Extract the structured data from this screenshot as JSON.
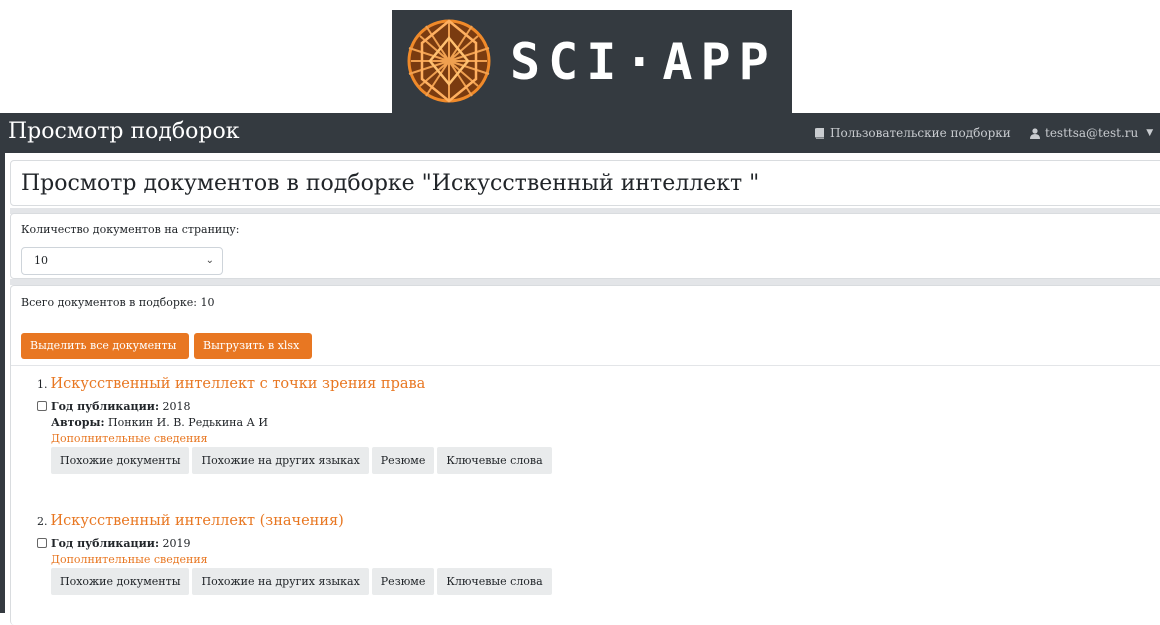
{
  "logo": {
    "text": "SCI·APP"
  },
  "navbar": {
    "brand": "Просмотр подборок",
    "collections_link": "Пользовательские подборки",
    "user": "testtsa@test.ru"
  },
  "page": {
    "title": "Просмотр документов в подборке \"Искусственный интеллект \""
  },
  "per_page": {
    "label": "Количество документов на страницу:",
    "selected": "10"
  },
  "list": {
    "total": "Всего документов в подборке: 10",
    "select_all": "Выделить все документы",
    "export": "Выгрузить в xlsx"
  },
  "labels": {
    "year": "Год публикации:",
    "authors": "Авторы:",
    "more": "Дополнительные сведения",
    "similar": "Похожие документы",
    "similar_other_lang": "Похожие на других языках",
    "summary": "Резюме",
    "keywords": "Ключевые слова"
  },
  "documents": [
    {
      "num": "1.",
      "title": "Искусственный интеллект с точки зрения права",
      "year": "2018",
      "authors": "Понкин И. В. Редькина А И"
    },
    {
      "num": "2.",
      "title": "Искусственный интеллект (значения)",
      "year": "2019"
    }
  ],
  "colors": {
    "accent": "#e87722",
    "navbar": "#343a40"
  },
  "icons": {
    "collections": "book-icon",
    "user": "user-icon",
    "dropdown": "caret-down-icon",
    "select": "chevron-down-icon"
  }
}
